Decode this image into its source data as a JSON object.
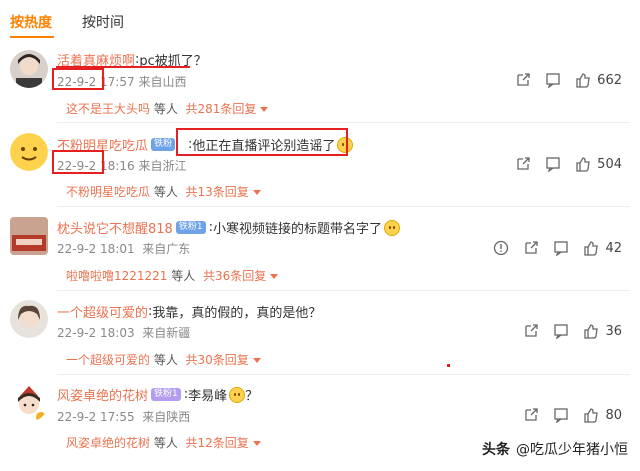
{
  "tabs": {
    "hot": "按热度",
    "time": "按时间"
  },
  "comments": [
    {
      "user": "活着真麻烦啊",
      "text": "pc被抓了？",
      "date": "22-9-2",
      "time": "17:57",
      "location": "来自山西",
      "likes": "662",
      "reply": {
        "user": "这不是王大头吗",
        "others": "等人",
        "count": "共281条回复"
      }
    },
    {
      "user": "不粉明星吃吃瓜",
      "badge": "铁粉",
      "text": "他正在直播评论别造谣了",
      "date": "22-9-2",
      "time": "18:16",
      "location": "来自浙江",
      "likes": "504",
      "reply": {
        "user": "不粉明星吃吃瓜",
        "others": "等人",
        "count": "共13条回复"
      }
    },
    {
      "user": "枕头说它不想醒818",
      "badge": "铁粉1",
      "text": "小寒视频链接的标题带名字了",
      "date": "22-9-2",
      "time": "18:01",
      "location": "来自广东",
      "likes": "42",
      "reply": {
        "user": "啦噜啦噜1221221",
        "others": "等人",
        "count": "共36条回复"
      }
    },
    {
      "user": "一个超级可爱的",
      "text": "我靠，真的假的，真的是他？",
      "date": "22-9-2",
      "time": "18:03",
      "location": "来自新疆",
      "likes": "36",
      "reply": {
        "user": "一个超级可爱的",
        "others": "等人",
        "count": "共30条回复"
      }
    },
    {
      "user": "风姿卓绝的花树",
      "badge": "铁粉1",
      "text": "李易峰",
      "text_suffix": "？",
      "date": "22-9-2",
      "time": "17:55",
      "location": "来自陕西",
      "likes": "80",
      "reply": {
        "user": "风姿卓绝的花树",
        "others": "等人",
        "count": "共12条回复"
      }
    }
  ],
  "watermark": {
    "logo": "头条",
    "account": "@吃瓜少年猪小恒"
  },
  "colors": {
    "accent": "#ff8200",
    "username": "#eb7350",
    "highlight": "#e62020"
  }
}
